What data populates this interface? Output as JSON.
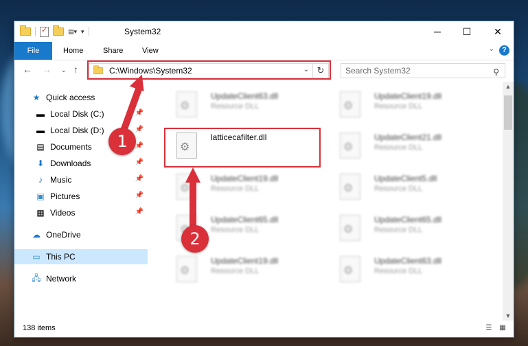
{
  "window": {
    "title": "System32",
    "colors": {
      "accent": "#1979ca",
      "highlight": "#d9303a",
      "selection": "#cce8ff"
    }
  },
  "ribbon": {
    "tabs": [
      {
        "label": "File"
      },
      {
        "label": "Home"
      },
      {
        "label": "Share"
      },
      {
        "label": "View"
      }
    ]
  },
  "address": {
    "path": "C:\\Windows\\System32",
    "search_placeholder": "Search System32"
  },
  "nav": {
    "quick_access": "Quick access",
    "items": [
      {
        "label": "Local Disk (C:)",
        "icon": "drive-icon"
      },
      {
        "label": "Local Disk (D:)",
        "icon": "drive-icon"
      },
      {
        "label": "Documents",
        "icon": "documents-icon"
      },
      {
        "label": "Downloads",
        "icon": "downloads-icon"
      },
      {
        "label": "Music",
        "icon": "music-icon"
      },
      {
        "label": "Pictures",
        "icon": "pictures-icon"
      },
      {
        "label": "Videos",
        "icon": "videos-icon"
      }
    ],
    "onedrive": "OneDrive",
    "this_pc": "This PC",
    "network": "Network"
  },
  "files": {
    "left": [
      {
        "name": "UpdateClient63.dll",
        "type": "Resource DLL"
      },
      {
        "name": "latticecafilter.dll",
        "type": ""
      },
      {
        "name": "UpdateClient19.dll",
        "type": "Resource DLL"
      },
      {
        "name": "UpdateClient65.dll",
        "type": "Resource DLL"
      },
      {
        "name": "UpdateClient19.dll",
        "type": "Resource DLL"
      }
    ],
    "right": [
      {
        "name": "UpdateClient19.dll",
        "type": "Resource DLL"
      },
      {
        "name": "UpdateClient21.dll",
        "type": "Resource DLL"
      },
      {
        "name": "UpdateClient5.dll",
        "type": "Resource DLL"
      },
      {
        "name": "UpdateClient65.dll",
        "type": "Resource DLL"
      },
      {
        "name": "UpdateClient63.dll",
        "type": "Resource DLL"
      }
    ]
  },
  "status": {
    "item_count": "138 items"
  },
  "annotations": {
    "step1": "1",
    "step2": "2"
  }
}
